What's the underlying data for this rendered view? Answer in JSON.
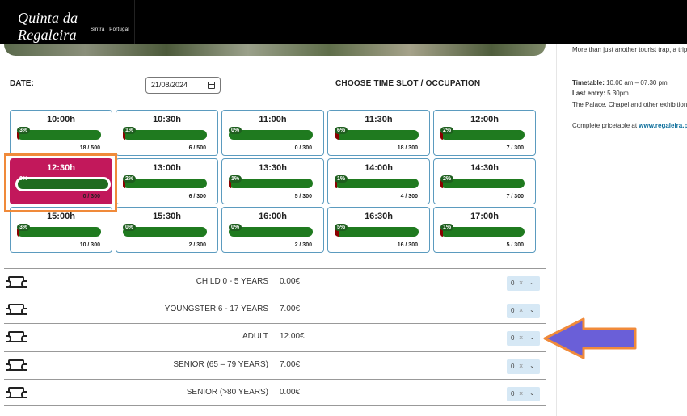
{
  "header": {
    "logo_text": "Quinta da Regaleira",
    "logo_subtext": "Sintra | Portugal"
  },
  "sidebar": {
    "intro": "More than just another tourist trap, a trip to",
    "timetable_label": "Timetable:",
    "timetable_value": "10.00 am – 07.30 pm",
    "last_entry_label": "Last entry:",
    "last_entry_value": "5.30pm",
    "note": "The Palace, Chapel and other exhibition ev",
    "pricetable_text": "Complete pricetable at",
    "pricetable_link": "www.regaleira.pt"
  },
  "booking": {
    "date_label": "DATE:",
    "date_value": "21/08/2024",
    "slot_heading": "CHOOSE TIME SLOT / OCCUPATION"
  },
  "slots": [
    {
      "time": "10:00h",
      "pct": "3%",
      "fraction": 0.03,
      "capacity": "18 / 500"
    },
    {
      "time": "10:30h",
      "pct": "1%",
      "fraction": 0.01,
      "capacity": "6 / 500"
    },
    {
      "time": "11:00h",
      "pct": "0%",
      "fraction": 0.0,
      "capacity": "0 / 300"
    },
    {
      "time": "11:30h",
      "pct": "6%",
      "fraction": 0.06,
      "capacity": "18 / 300"
    },
    {
      "time": "12:00h",
      "pct": "2%",
      "fraction": 0.02,
      "capacity": "7 / 300"
    },
    {
      "time": "12:30h",
      "pct": "0%",
      "fraction": 0.0,
      "capacity": "0 / 300",
      "selected": true
    },
    {
      "time": "13:00h",
      "pct": "2%",
      "fraction": 0.02,
      "capacity": "6 / 300"
    },
    {
      "time": "13:30h",
      "pct": "1%",
      "fraction": 0.01,
      "capacity": "5 / 300"
    },
    {
      "time": "14:00h",
      "pct": "1%",
      "fraction": 0.01,
      "capacity": "4 / 300"
    },
    {
      "time": "14:30h",
      "pct": "2%",
      "fraction": 0.02,
      "capacity": "7 / 300"
    },
    {
      "time": "15:00h",
      "pct": "3%",
      "fraction": 0.03,
      "capacity": "10 / 300"
    },
    {
      "time": "15:30h",
      "pct": "0%",
      "fraction": 0.0,
      "capacity": "2 / 300"
    },
    {
      "time": "16:00h",
      "pct": "0%",
      "fraction": 0.0,
      "capacity": "2 / 300"
    },
    {
      "time": "16:30h",
      "pct": "5%",
      "fraction": 0.05,
      "capacity": "16 / 300"
    },
    {
      "time": "17:00h",
      "pct": "1%",
      "fraction": 0.01,
      "capacity": "5 / 300"
    }
  ],
  "tickets": [
    {
      "name": "CHILD 0 - 5 YEARS",
      "price": "0.00€",
      "qty": "0"
    },
    {
      "name": "YOUNGSTER 6 - 17 YEARS",
      "price": "7.00€",
      "qty": "0"
    },
    {
      "name": "ADULT",
      "price": "12.00€",
      "qty": "0"
    },
    {
      "name": "SENIOR (65 – 79 YEARS)",
      "price": "7.00€",
      "qty": "0"
    },
    {
      "name": "SENIOR (>80 YEARS)",
      "price": "0.00€",
      "qty": "0"
    }
  ],
  "icons": {
    "clear": "×",
    "chevron": "⌄"
  },
  "colors": {
    "selected_slot": "#c2185b",
    "bar_green": "#1f7a1f",
    "annotation_orange": "#f08a3a",
    "annotation_arrow": "#6a5fd8"
  }
}
